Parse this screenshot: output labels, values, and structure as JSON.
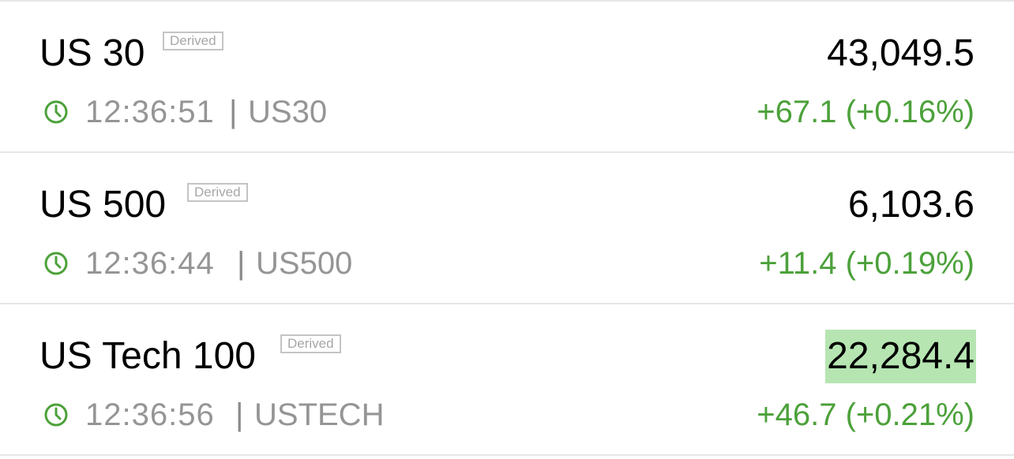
{
  "colors": {
    "positive": "#4ca13a",
    "flash_highlight": "#b6e5b2",
    "muted_text": "#959595",
    "badge_border": "#c4c4c4"
  },
  "instruments": [
    {
      "name": "US 30",
      "badge": "Derived",
      "price": "43,049.5",
      "time": "12:36:51",
      "separator": "|",
      "symbol": "US30",
      "change": "+67.1 (+0.16%)",
      "icon": "clock-icon"
    },
    {
      "name": "US 500",
      "badge": "Derived",
      "price": "6,103.6",
      "time": "12:36:44",
      "separator": "|",
      "symbol": "US500",
      "change": "+11.4 (+0.19%)",
      "icon": "clock-icon"
    },
    {
      "name": "US Tech 100",
      "badge": "Derived",
      "price": "22,284.4",
      "time": "12:36:56",
      "separator": "|",
      "symbol": "USTECH",
      "change": "+46.7 (+0.21%)",
      "icon": "clock-icon"
    }
  ]
}
